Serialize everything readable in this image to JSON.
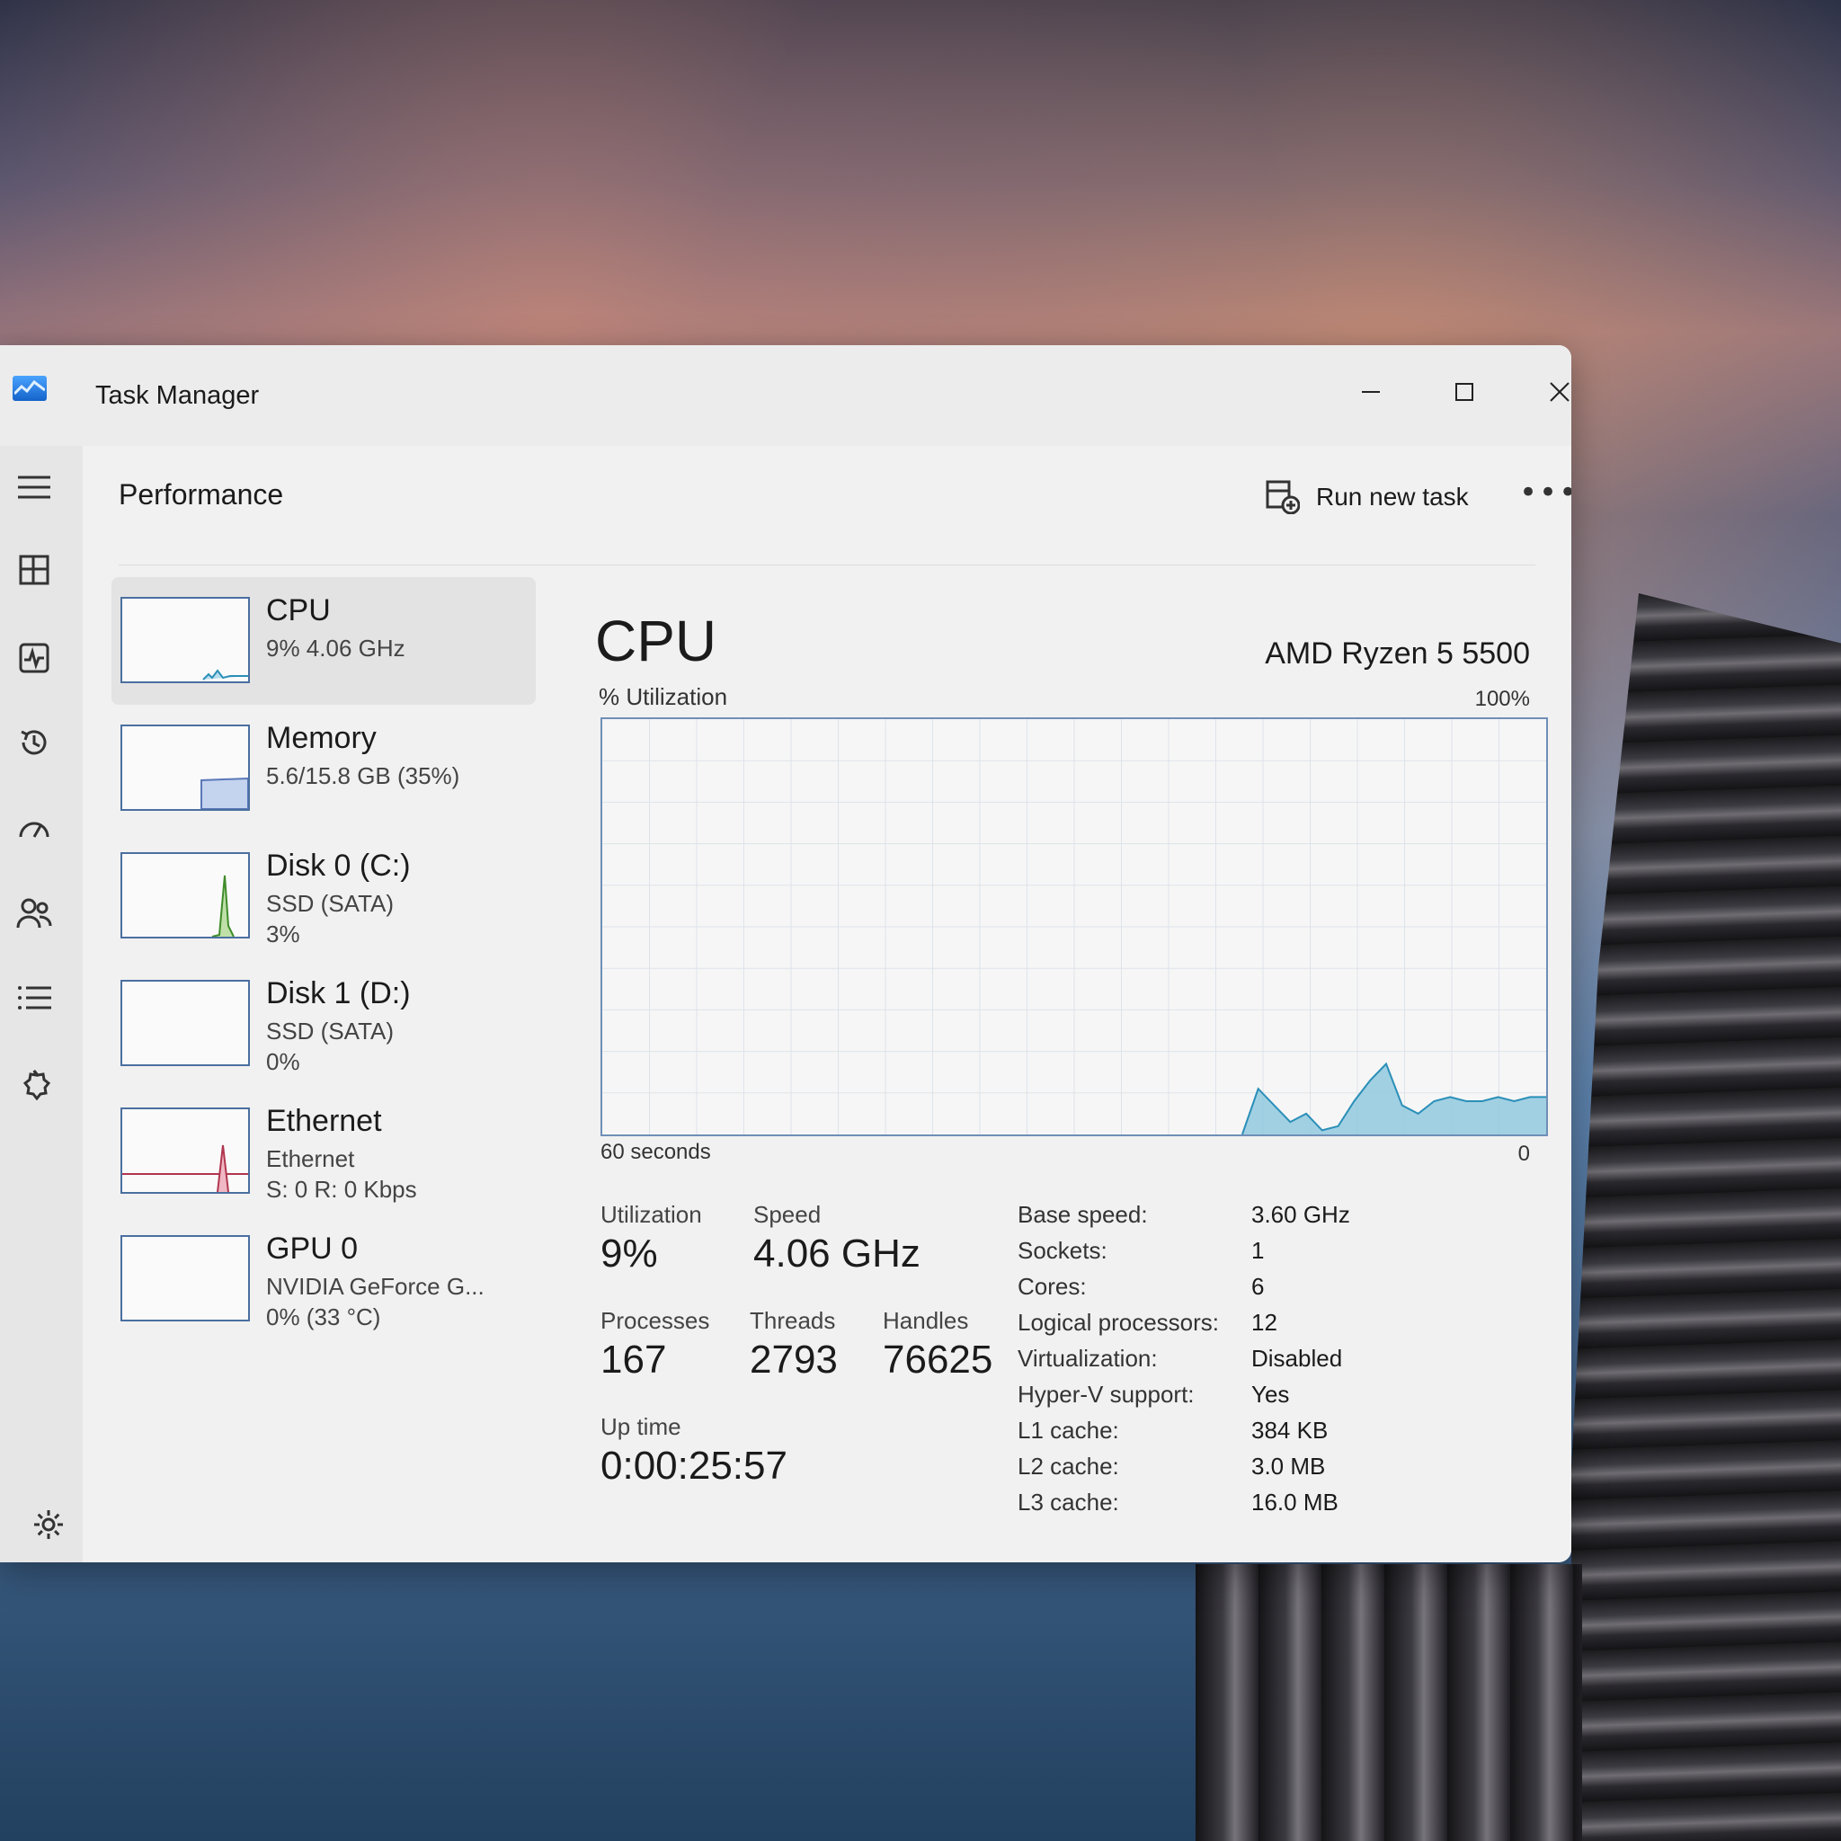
{
  "window": {
    "title": "Task Manager",
    "controls": {
      "minimize": "—",
      "maximize": "☐",
      "close": "✕"
    }
  },
  "nav": {
    "icons": [
      "hamburger-icon",
      "processes-icon",
      "performance-icon",
      "app-history-icon",
      "startup-apps-icon",
      "users-icon",
      "details-icon",
      "services-icon",
      "settings-icon"
    ]
  },
  "header": {
    "page_title": "Performance",
    "run_new_task": "Run new task",
    "more": "•••"
  },
  "devices": [
    {
      "name": "CPU",
      "line1": "9%  4.06 GHz",
      "line2": "",
      "color": "#4a6fa0"
    },
    {
      "name": "Memory",
      "line1": "5.6/15.8 GB (35%)",
      "line2": "",
      "color": "#8a56b8"
    },
    {
      "name": "Disk 0 (C:)",
      "line1": "SSD (SATA)",
      "line2": "3%",
      "color": "#3f8c2a"
    },
    {
      "name": "Disk 1 (D:)",
      "line1": "SSD (SATA)",
      "line2": "0%",
      "color": "#3f8c2a"
    },
    {
      "name": "Ethernet",
      "line1": "Ethernet",
      "line2": "S: 0 R: 0 Kbps",
      "color": "#b0364f"
    },
    {
      "name": "GPU 0",
      "line1": "NVIDIA GeForce G...",
      "line2": "0% (33 °C)",
      "color": "#2f5fa0"
    }
  ],
  "cpu": {
    "title": "CPU",
    "model": "AMD Ryzen 5 5500",
    "util_label": "% Utilization",
    "util_max": "100%",
    "axis_left": "60 seconds",
    "axis_right": "0",
    "graph_color": "#8cc7dd",
    "graph_line": "#2a8fb8"
  },
  "stats": {
    "utilization_label": "Utilization",
    "utilization": "9%",
    "speed_label": "Speed",
    "speed": "4.06 GHz",
    "processes_label": "Processes",
    "processes": "167",
    "threads_label": "Threads",
    "threads": "2793",
    "handles_label": "Handles",
    "handles": "76625",
    "uptime_label": "Up time",
    "uptime": "0:00:25:57"
  },
  "specs": [
    {
      "label": "Base speed:",
      "value": "3.60 GHz"
    },
    {
      "label": "Sockets:",
      "value": "1"
    },
    {
      "label": "Cores:",
      "value": "6"
    },
    {
      "label": "Logical processors:",
      "value": "12"
    },
    {
      "label": "Virtualization:",
      "value": "Disabled"
    },
    {
      "label": "Hyper-V support:",
      "value": "Yes"
    },
    {
      "label": "L1 cache:",
      "value": "384 KB"
    },
    {
      "label": "L2 cache:",
      "value": "3.0 MB"
    },
    {
      "label": "L3 cache:",
      "value": "16.0 MB"
    }
  ],
  "cpu_history": [
    0,
    0,
    0,
    0,
    0,
    0,
    0,
    0,
    0,
    0,
    0,
    0,
    0,
    0,
    0,
    0,
    0,
    0,
    0,
    0,
    0,
    0,
    0,
    0,
    0,
    0,
    0,
    0,
    0,
    0,
    0,
    0,
    0,
    0,
    0,
    0,
    0,
    0,
    0,
    0,
    0,
    11,
    7,
    3,
    5,
    1,
    2,
    8,
    13,
    17,
    7,
    5,
    8,
    9,
    8,
    8,
    9,
    8,
    9,
    9
  ]
}
